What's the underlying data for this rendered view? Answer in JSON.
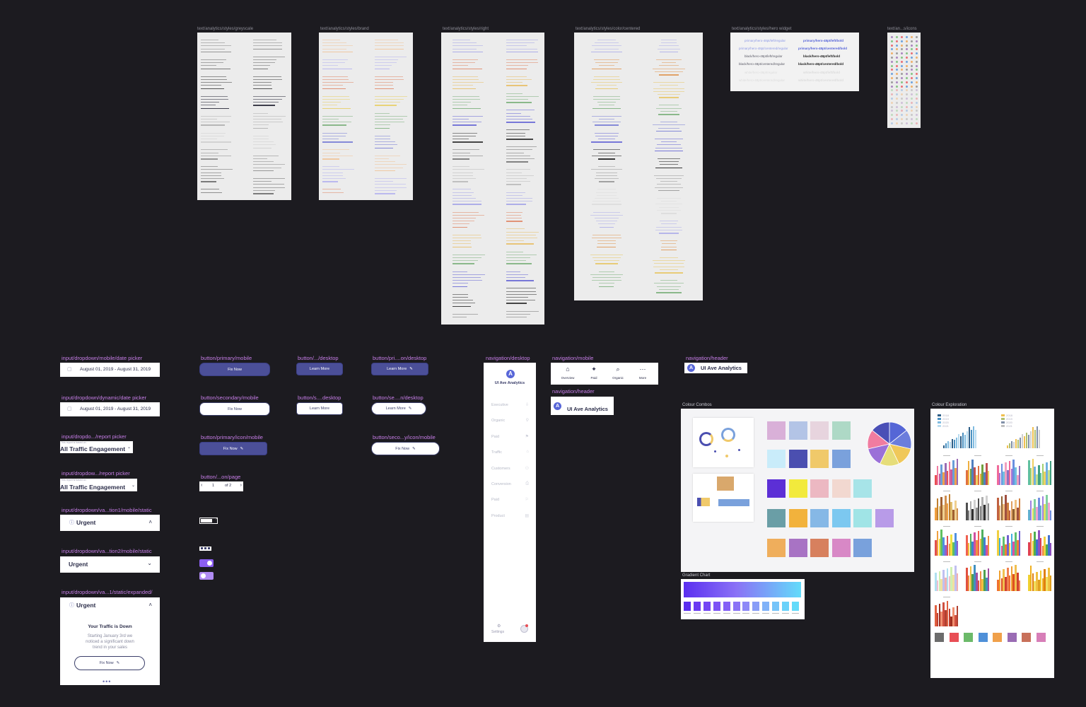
{
  "text_frames": [
    {
      "label": "text/analytics/styles/greyscale"
    },
    {
      "label": "text/analytics/styles/brand"
    },
    {
      "label": "text/analytics/styles/right"
    },
    {
      "label": "text/analytics/styles/color/centered"
    },
    {
      "label": "text/analytics/styles/hero widget"
    },
    {
      "label": "text/an...s/icons"
    }
  ],
  "hero_widget": {
    "left": [
      "primary/hero-48pt/left/regular",
      "primary/hero-48pt/centered/regular",
      "black/hero-48pt/left/regular",
      "black/hero-48pt/centered/regular",
      "white/hero-48pt/regular",
      "white/hero-48pt/centered/regular"
    ],
    "right": [
      "primary/hero-48pt/left/bold",
      "primary/hero-48pt/centered/bold",
      "black/hero-48pt/left/bold",
      "black/hero-48pt/centered/bold",
      "white/hero-48pt/left/bold",
      "white/hero-48pt/centered/bold"
    ]
  },
  "components": {
    "date_picker_mobile": {
      "label": "input/dropdown/mobile/date picker",
      "value": "August 01, 2019 - August 31, 2019"
    },
    "date_picker_dynamic": {
      "label": "input/dropdown/dynamic/date picker",
      "value": "August 01, 2019 - August 31, 2019"
    },
    "report_picker_1": {
      "label": "input/dropdo.../report picker",
      "hint": "This report is based on",
      "value": "All Traffic Engagement"
    },
    "report_picker_2": {
      "label": "input/dropdow.../report picker",
      "hint": "This report is based on",
      "value": "All Traffic Engagement"
    },
    "variation1": {
      "label": "input/dropdown/va...tion1/mobile/static",
      "value": "Urgent"
    },
    "variation2": {
      "label": "input/dropdown/va...tion2/mobile/static",
      "value": "Urgent"
    },
    "expanded": {
      "label": "input/dropdown/va...1/static/expanded/",
      "value": "Urgent",
      "title": "Your Traffic is Down",
      "body1": "Starting January 3rd we",
      "body2": "noticed a significant down",
      "body3": "trend in your sales",
      "button": "Fix Now"
    },
    "btn_primary_mobile": {
      "label": "button/primary/mobile",
      "text": "Fix Now"
    },
    "btn_desktop": {
      "label": "button/.../desktop",
      "text": "Learn More"
    },
    "btn_pri_desktop": {
      "label": "button/pri....on/desktop",
      "text": "Learn More"
    },
    "btn_secondary_mobile": {
      "label": "button/secondary/mobile",
      "text": "Fix Now"
    },
    "btn_s_desktop": {
      "label": "button/s....desktop",
      "text": "Learn More"
    },
    "btn_se_desktop": {
      "label": "button/se....n/desktop",
      "text": "Learn More"
    },
    "btn_primary_icon_mobile": {
      "label": "button/primary/icon/mobile",
      "text": "Fix Now"
    },
    "btn_seco_icon_mobile": {
      "label": "button/seco...y/icon/mobile",
      "text": "Fix Now"
    },
    "pagination": {
      "label": "button/...on/page",
      "page": "1",
      "of": "of 2"
    }
  },
  "nav_desktop": {
    "label": "navigation/desktop",
    "brand": "UI Ave Analytics",
    "items": [
      "Executive",
      "Organic",
      "Paid",
      "Traffic",
      "Customers",
      "Conversion",
      "Paid",
      "Product"
    ],
    "settings": "Settings"
  },
  "nav_mobile": {
    "label": "navigation/mobile",
    "items": [
      "Overview",
      "Paid",
      "Organic",
      "More"
    ]
  },
  "nav_header_1": {
    "label": "navigation/header",
    "brand": "UI Ave Analytics"
  },
  "nav_header_2": {
    "label": "navigation/header",
    "brand": "UI Ave Analytics"
  },
  "colour_combos": {
    "label": "Colour Combos",
    "palette": [
      [
        "#d9b0d8",
        "#b3c4e6",
        "#e7d4de",
        "#aed9c6"
      ],
      [
        "#c9ecfa",
        "#4b4fb0",
        "#f0c96a",
        "#7aa1dc"
      ],
      [
        "#5c2fd6",
        "#f2ea3c",
        "#ecb8c2",
        "#f2d8d0",
        "#a7e4e8"
      ],
      [
        "#6a9ea6",
        "#f2b23c",
        "#86b8e6",
        "#7cc8f0",
        "#a0e4e6",
        "#b89be8"
      ],
      [
        "#efae5c",
        "#a873c4",
        "#d7805e",
        "#d888c6",
        "#79a1dc"
      ]
    ],
    "pie": [
      "#5566d6",
      "#6b7ddc",
      "#f0c85a",
      "#e6dd7a",
      "#9b70d8",
      "#f07ca0",
      "#4a4fb6"
    ]
  },
  "gradient_chart": {
    "label": "Gradient Chart",
    "colors": [
      "#5b2ff0",
      "#6a3af2",
      "#7345f4",
      "#7c52f5",
      "#8460f6",
      "#8a72f6",
      "#8d88f7",
      "#889df7",
      "#80b2f8",
      "#75c4f9",
      "#6ad2fa",
      "#63dbfa"
    ]
  },
  "colour_exploration": {
    "label": "Colour Exploration",
    "legend": [
      "2018",
      "2019",
      "2020",
      "2021"
    ],
    "bottom_swatches": [
      "#6c6c6c",
      "#e84e55",
      "#6cba6a",
      "#4f90d8",
      "#f0a04a",
      "#9a6cb4",
      "#c8705a",
      "#d77eb8"
    ]
  }
}
